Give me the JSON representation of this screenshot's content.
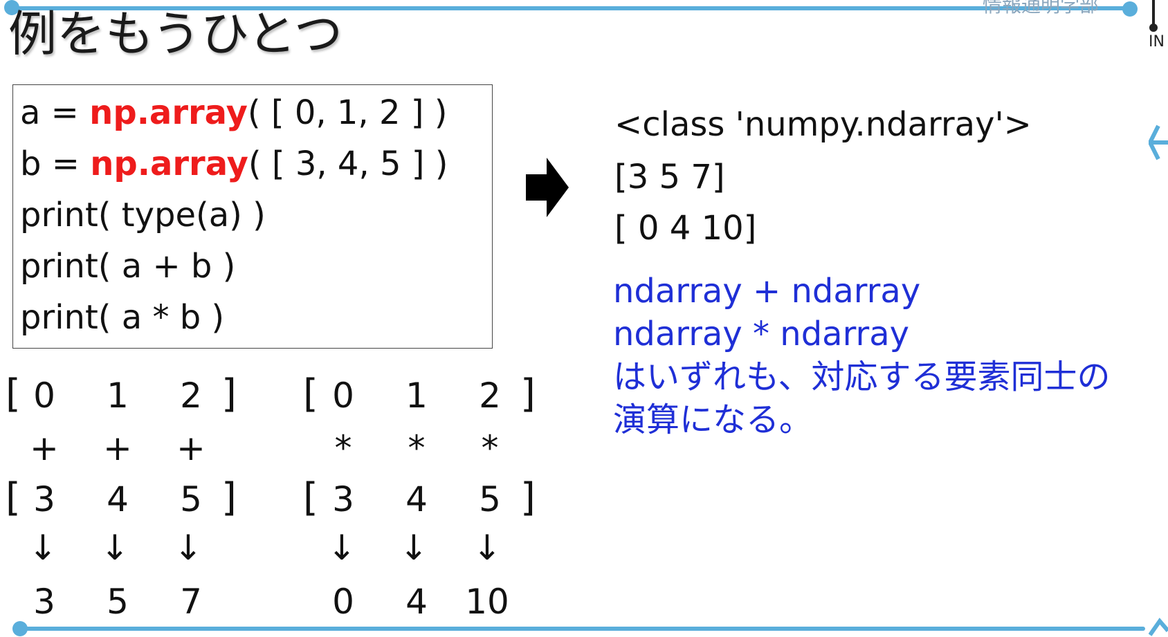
{
  "header": {
    "title": "例をもうひとつ",
    "corner_text": "情報通明学部",
    "logo_text": "IN"
  },
  "code": {
    "line1_pre": "a = ",
    "line1_fn": "np.array",
    "line1_post": "( [ 0, 1, 2 ] )",
    "line2_pre": "b = ",
    "line2_fn": "np.array",
    "line2_post": "( [ 3, 4, 5 ] )",
    "line3": "print( type(a) )",
    "line4": "print( a + b )",
    "line5": "print( a * b )"
  },
  "output": {
    "line1": "<class 'numpy.ndarray'>",
    "line2": "[3 5 7]",
    "line3": "[ 0  4 10]"
  },
  "note": {
    "line1": "ndarray + ndarray",
    "line2": "ndarray * ndarray",
    "line3": "はいずれも、対応する要素同士の",
    "line4": "演算になる。"
  },
  "add_example": {
    "a": [
      "0",
      "1",
      "2"
    ],
    "op": "+",
    "b": [
      "3",
      "4",
      "5"
    ],
    "down": "↓",
    "result": [
      "3",
      "5",
      "7"
    ]
  },
  "mul_example": {
    "a": [
      "0",
      "1",
      "2"
    ],
    "op": "*",
    "b": [
      "3",
      "4",
      "5"
    ],
    "down": "↓",
    "result": [
      "0",
      "4",
      "10"
    ]
  },
  "brackets": {
    "open": "[",
    "close": "]"
  },
  "icons": [
    "right-arrow-icon",
    "logo-icon"
  ],
  "colors": {
    "accent_line": "#5aaedb",
    "keyword_red": "#ee1c1c",
    "note_blue": "#1f2fd6"
  }
}
